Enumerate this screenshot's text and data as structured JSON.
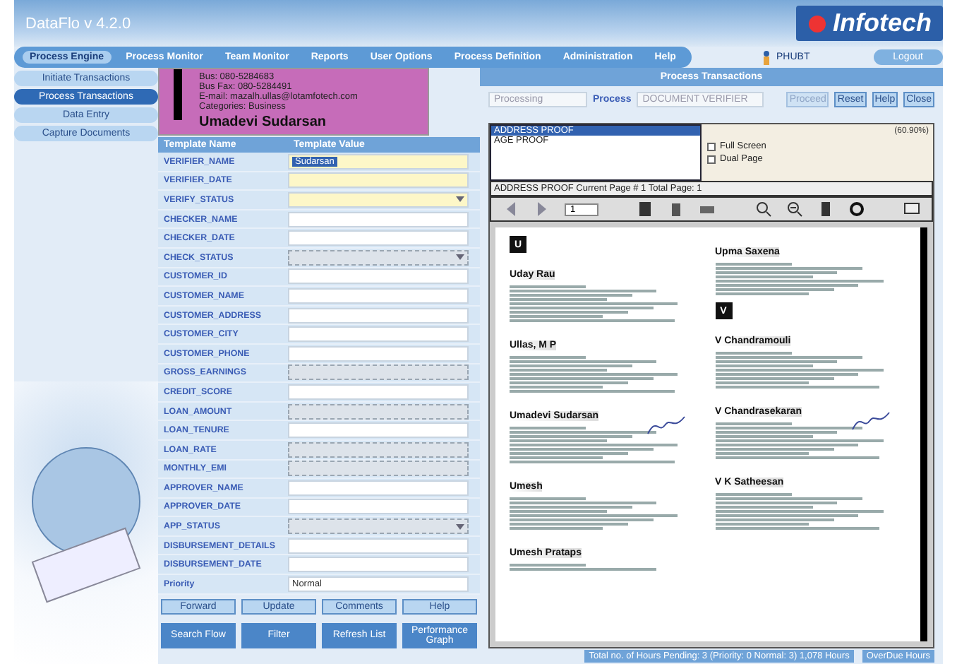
{
  "window": {
    "title": "DataFlo v 4.2.0",
    "logo": "Infotech"
  },
  "nav": [
    {
      "label": "Process Engine",
      "selected": true
    },
    {
      "label": "Process Monitor",
      "selected": false
    },
    {
      "label": "Team Monitor",
      "selected": false
    },
    {
      "label": "Reports",
      "selected": false
    },
    {
      "label": "User Options",
      "selected": false
    },
    {
      "label": "Process Definition",
      "selected": false
    },
    {
      "label": "Administration",
      "selected": false
    },
    {
      "label": "Help",
      "selected": false
    }
  ],
  "user": "PHUBT",
  "logout": "Logout",
  "sidebar": {
    "items": [
      {
        "label": "Initiate Transactions",
        "selected": false
      },
      {
        "label": "Process Transactions",
        "selected": true
      },
      {
        "label": "Data Entry",
        "selected": false
      },
      {
        "label": "Capture Documents",
        "selected": false
      }
    ]
  },
  "popup": {
    "lines": [
      "Bus:   080-5284683",
      "Bus Fax:   080-5284491",
      "E-mail:   mazalh.ullas@lotamfotech.com",
      "Categories:   Business"
    ],
    "heading": "Umadevi Sudarsan"
  },
  "panel_title": "Process Transactions",
  "filter": {
    "status": "Processing",
    "process_label": "Process",
    "process": "DOCUMENT VERIFIER"
  },
  "actions": [
    {
      "label": "Proceed",
      "disabled": true
    },
    {
      "label": "Reset",
      "disabled": false
    },
    {
      "label": "Help",
      "disabled": false
    },
    {
      "label": "Close",
      "disabled": false
    }
  ],
  "table": {
    "columns": [
      "Template Name",
      "Template Value"
    ],
    "rows": [
      {
        "name": "VERIFIER_NAME",
        "kind": "text",
        "value": "Sudarsan",
        "mandatory": true,
        "disabled": false
      },
      {
        "name": "VERIFIER_DATE",
        "kind": "text",
        "mandatory": true,
        "disabled": false
      },
      {
        "name": "VERIFY_STATUS",
        "kind": "select",
        "mandatory": true,
        "disabled": false
      },
      {
        "name": "CHECKER_NAME",
        "kind": "text",
        "mandatory": false,
        "disabled": false
      },
      {
        "name": "CHECKER_DATE",
        "kind": "text",
        "mandatory": false,
        "disabled": false
      },
      {
        "name": "CHECK_STATUS",
        "kind": "select",
        "mandatory": false,
        "disabled": true
      },
      {
        "name": "CUSTOMER_ID",
        "kind": "text",
        "mandatory": false,
        "disabled": false
      },
      {
        "name": "CUSTOMER_NAME",
        "kind": "text",
        "mandatory": false,
        "disabled": false
      },
      {
        "name": "CUSTOMER_ADDRESS",
        "kind": "text",
        "mandatory": false,
        "disabled": false
      },
      {
        "name": "CUSTOMER_CITY",
        "kind": "text",
        "mandatory": false,
        "disabled": false
      },
      {
        "name": "CUSTOMER_PHONE",
        "kind": "text",
        "mandatory": false,
        "disabled": false
      },
      {
        "name": "GROSS_EARNINGS",
        "kind": "text",
        "mandatory": false,
        "disabled": true
      },
      {
        "name": "CREDIT_SCORE",
        "kind": "text",
        "mandatory": false,
        "disabled": false
      },
      {
        "name": "LOAN_AMOUNT",
        "kind": "text",
        "mandatory": false,
        "disabled": true
      },
      {
        "name": "LOAN_TENURE",
        "kind": "text",
        "mandatory": false,
        "disabled": false
      },
      {
        "name": "LOAN_RATE",
        "kind": "text",
        "mandatory": false,
        "disabled": true
      },
      {
        "name": "MONTHLY_EMI",
        "kind": "text",
        "mandatory": false,
        "disabled": true
      },
      {
        "name": "APPROVER_NAME",
        "kind": "text",
        "mandatory": false,
        "disabled": false
      },
      {
        "name": "APPROVER_DATE",
        "kind": "text",
        "mandatory": false,
        "disabled": false
      },
      {
        "name": "APP_STATUS",
        "kind": "select",
        "mandatory": false,
        "disabled": true
      },
      {
        "name": "DISBURSEMENT_DETAILS",
        "kind": "text",
        "mandatory": false,
        "disabled": false
      },
      {
        "name": "DISBURSEMENT_DATE",
        "kind": "text",
        "mandatory": false,
        "disabled": false
      },
      {
        "name": "Priority",
        "kind": "text",
        "value": "Normal",
        "mandatory": false,
        "disabled": false
      }
    ]
  },
  "form_buttons": [
    "Forward",
    "Update",
    "Comments",
    "Help"
  ],
  "bottom_buttons": [
    "Search Flow",
    "Filter",
    "Refresh List",
    "Performance Graph"
  ],
  "viewer": {
    "documents": [
      {
        "label": "ADDRESS PROOF",
        "selected": true
      },
      {
        "label": "AGE PROOF",
        "selected": false
      }
    ],
    "options": [
      {
        "label": "Full Screen",
        "checked": false
      },
      {
        "label": "Dual Page",
        "checked": false
      }
    ],
    "zoom": "(60.90%)",
    "status": "ADDRESS PROOF Current Page # 1   Total Page: 1",
    "page": "1",
    "columns": [
      [
        {
          "kind": "letter",
          "text": "U"
        },
        {
          "kind": "entry",
          "text": "Uday Rau"
        },
        {
          "kind": "entry",
          "text": "Ullas, M P"
        },
        {
          "kind": "entry",
          "text": "Umadevi Sudarsan",
          "signed": true
        },
        {
          "kind": "entry",
          "text": "Umesh"
        },
        {
          "kind": "entry",
          "text": "Umesh Prataps"
        }
      ],
      [
        {
          "kind": "entry",
          "text": "Upma Saxena"
        },
        {
          "kind": "letter",
          "text": "V"
        },
        {
          "kind": "entry",
          "text": "V Chandramouli"
        },
        {
          "kind": "entry",
          "text": "V Chandrasekaran",
          "signed": true
        },
        {
          "kind": "entry",
          "text": "V K Satheesan"
        }
      ]
    ]
  },
  "status_bar": {
    "pending": "Total no. of Hours Pending: 3 (Priority: 0 Normal: 3) 1,078 Hours",
    "overdue": "OverDue Hours"
  }
}
